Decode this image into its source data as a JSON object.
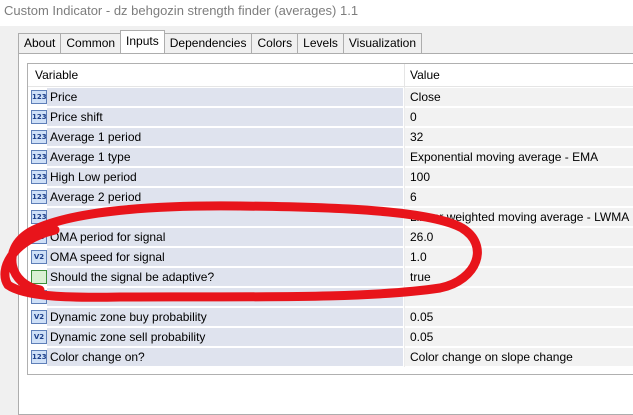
{
  "window": {
    "title": "Custom Indicator - dz behgozin strength finder (averages) 1.1"
  },
  "tabs": [
    {
      "label": "About"
    },
    {
      "label": "Common"
    },
    {
      "label": "Inputs",
      "active": true
    },
    {
      "label": "Dependencies"
    },
    {
      "label": "Colors"
    },
    {
      "label": "Levels"
    },
    {
      "label": "Visualization"
    }
  ],
  "table": {
    "headers": {
      "variable": "Variable",
      "value": "Value"
    },
    "rows": [
      {
        "icon": "int-icon",
        "icon_text": "123",
        "name": "Price",
        "value": "Close"
      },
      {
        "icon": "int-icon",
        "icon_text": "123",
        "name": "Price shift",
        "value": "0"
      },
      {
        "icon": "int-icon",
        "icon_text": "123",
        "name": "Average 1 period",
        "value": "32"
      },
      {
        "icon": "int-icon",
        "icon_text": "123",
        "name": "Average 1 type",
        "value": "Exponential moving average - EMA"
      },
      {
        "icon": "int-icon",
        "icon_text": "123",
        "name": "High Low period",
        "value": "100"
      },
      {
        "icon": "int-icon",
        "icon_text": "123",
        "name": "Average 2 period",
        "value": "6"
      },
      {
        "icon": "int-icon",
        "icon_text": "123",
        "name": "",
        "value": "Linear weighted moving average - LWMA"
      },
      {
        "icon": "double-icon",
        "icon_text": "V2",
        "name": "OMA period for signal",
        "value": "26.0"
      },
      {
        "icon": "double-icon",
        "icon_text": "V2",
        "name": "OMA speed for signal",
        "value": "1.0"
      },
      {
        "icon": "bool-icon",
        "icon_text": "",
        "name": "Should the signal be adaptive?",
        "value": "true"
      },
      {
        "icon": "int-icon",
        "icon_text": "",
        "name": "",
        "value": ""
      },
      {
        "icon": "double-icon",
        "icon_text": "V2",
        "name": "Dynamic zone buy probability",
        "value": "0.05"
      },
      {
        "icon": "double-icon",
        "icon_text": "V2",
        "name": "Dynamic zone sell probability",
        "value": "0.05"
      },
      {
        "icon": "int-icon",
        "icon_text": "123",
        "name": "Color change on?",
        "value": "Color change on slope change"
      }
    ]
  },
  "annotation": {
    "color": "#e8141b"
  }
}
